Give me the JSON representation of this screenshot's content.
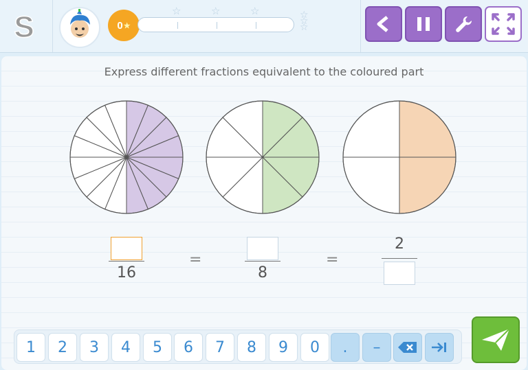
{
  "header": {
    "logo_letter": "S",
    "coins": "0",
    "toolbar": [
      "back-icon",
      "pause-icon",
      "wrench-icon",
      "fullscreen-icon"
    ]
  },
  "exercise": {
    "instruction": "Express different fractions equivalent to the coloured part",
    "circles": [
      {
        "slices": 16,
        "filled": 8,
        "fill_color": "#d6c8e6"
      },
      {
        "slices": 8,
        "filled": 4,
        "fill_color": "#cfe6c2"
      },
      {
        "slices": 4,
        "filled": 2,
        "fill_color": "#f6d5b5"
      }
    ],
    "fraction1": {
      "numerator": "",
      "denominator": "16"
    },
    "fraction2": {
      "numerator": "",
      "denominator": "8"
    },
    "fraction3": {
      "numerator": "2",
      "denominator": ""
    },
    "equals": "="
  },
  "keypad": {
    "keys": [
      "1",
      "2",
      "3",
      "4",
      "5",
      "6",
      "7",
      "8",
      "9",
      "0",
      ".",
      "–"
    ],
    "backspace_icon": "backspace-icon",
    "tab_icon": "tab-icon"
  },
  "submit_icon": "paper-plane-icon",
  "colors": {
    "accent_purple": "#9b6ec9",
    "submit_green": "#6ebe3b",
    "key_blue": "#3a8ad0",
    "coin_orange": "#f5a623"
  }
}
